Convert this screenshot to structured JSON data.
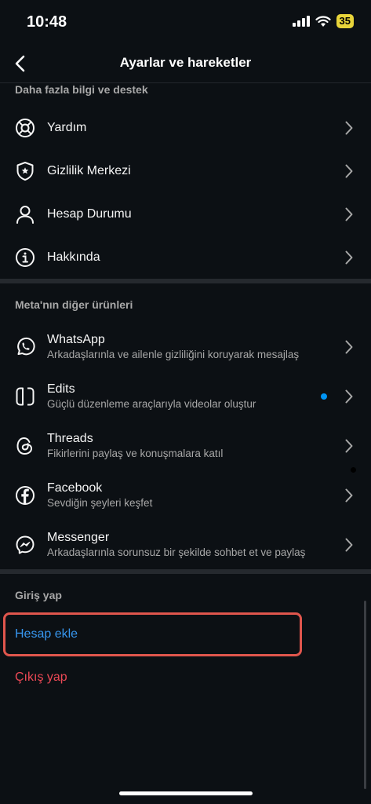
{
  "status_bar": {
    "time": "10:48",
    "battery": "35"
  },
  "nav": {
    "title": "Ayarlar ve hareketler"
  },
  "support": {
    "header": "Daha fazla bilgi ve destek",
    "items": [
      {
        "label": "Yardım",
        "icon": "lifebuoy-icon"
      },
      {
        "label": "Gizlilik Merkezi",
        "icon": "shield-star-icon"
      },
      {
        "label": "Hesap Durumu",
        "icon": "person-icon"
      },
      {
        "label": "Hakkında",
        "icon": "info-icon"
      }
    ]
  },
  "meta": {
    "header": "Meta'nın diğer ürünleri",
    "items": [
      {
        "label": "WhatsApp",
        "sub": "Arkadaşlarınla ve ailenle gizliliğini koruyarak mesajlaş",
        "icon": "whatsapp-icon"
      },
      {
        "label": "Edits",
        "sub": "Güçlü düzenleme araçlarıyla videolar oluştur",
        "icon": "edits-icon",
        "new_dot": true
      },
      {
        "label": "Threads",
        "sub": "Fikirlerini paylaş ve konuşmalara katıl",
        "icon": "threads-icon"
      },
      {
        "label": "Facebook",
        "sub": "Sevdiğin şeyleri keşfet",
        "icon": "facebook-icon"
      },
      {
        "label": "Messenger",
        "sub": "Arkadaşlarınla sorunsuz bir şekilde sohbet et ve paylaş",
        "icon": "messenger-icon"
      }
    ]
  },
  "login": {
    "header": "Giriş yap",
    "add_account": "Hesap ekle",
    "logout": "Çıkış yap"
  },
  "colors": {
    "link": "#3797f0",
    "danger": "#ed4956",
    "highlight": "#e0564d",
    "dot": "#0095f6"
  }
}
